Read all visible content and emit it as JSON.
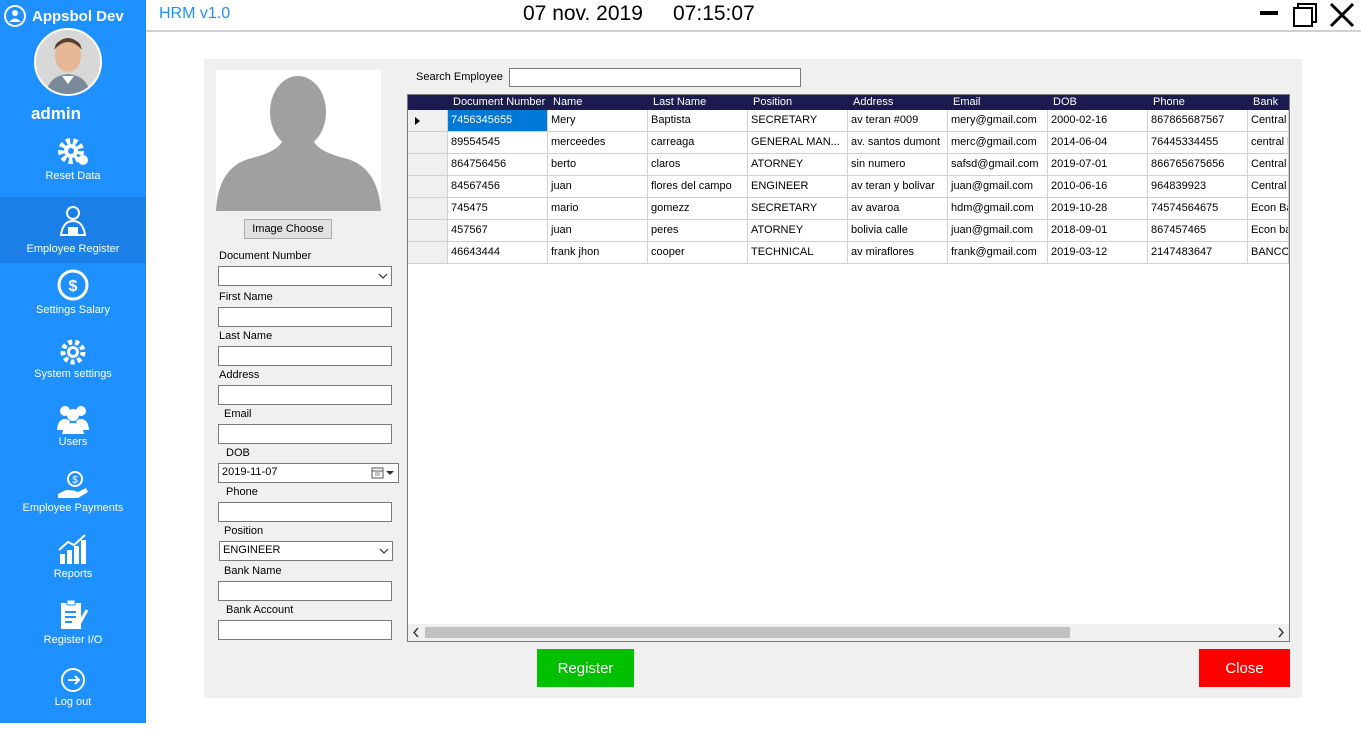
{
  "brand": {
    "name": "Appsbol Dev"
  },
  "user": {
    "name": "admin"
  },
  "nav": [
    {
      "label": "Reset Data",
      "icon": "gear-icon"
    },
    {
      "label": "Employee Register",
      "icon": "employee-icon"
    },
    {
      "label": "Settings Salary",
      "icon": "salary-icon"
    },
    {
      "label": "System settings",
      "icon": "settings-icon"
    },
    {
      "label": "Users",
      "icon": "users-icon"
    },
    {
      "label": "Employee Payments",
      "icon": "payments-icon"
    },
    {
      "label": "Reports",
      "icon": "chart-icon"
    },
    {
      "label": "Register I/O",
      "icon": "clipboard-icon"
    },
    {
      "label": "Log out",
      "icon": "logout-icon"
    }
  ],
  "header": {
    "app": "HRM v1.0",
    "date": "07 nov. 2019",
    "time": "07:15:07"
  },
  "form": {
    "image_button": "Image Choose",
    "document_number_label": "Document Number",
    "first_name_label": "First Name",
    "last_name_label": "Last Name",
    "address_label": "Address",
    "email_label": "Email",
    "dob_label": "DOB",
    "dob_value": "2019-11-07",
    "phone_label": "Phone",
    "position_label": "Position",
    "position_value": "ENGINEER",
    "bank_name_label": "Bank Name",
    "bank_account_label": "Bank Account"
  },
  "search": {
    "label": "Search Employee"
  },
  "table": {
    "columns": [
      "Document Number",
      "Name",
      "Last Name",
      "Position",
      "Address",
      "Email",
      "DOB",
      "Phone",
      "Bank"
    ],
    "rows": [
      [
        "7456345655",
        "Mery",
        "Baptista",
        "SECRETARY",
        "av teran #009",
        "mery@gmail.com",
        "2000-02-16",
        "867865687567",
        "Central"
      ],
      [
        "89554545",
        "merceedes",
        "carreaga",
        "GENERAL MAN...",
        "av. santos dumont",
        "merc@gmail.com",
        "2014-06-04",
        "76445334455",
        "central b"
      ],
      [
        "864756456",
        "berto",
        "claros",
        "ATORNEY",
        "sin numero",
        "safsd@gmail.com",
        "2019-07-01",
        "866765675656",
        "Central"
      ],
      [
        "84567456",
        "juan",
        "flores del campo",
        "ENGINEER",
        "av teran y bolivar",
        "juan@gmail.com",
        "2010-06-16",
        "964839923",
        "Central"
      ],
      [
        "745475",
        "mario",
        "gomezz",
        "SECRETARY",
        "av avaroa",
        "hdm@gmail.com",
        "2019-10-28",
        "74574564675",
        "Econ Ba"
      ],
      [
        "457567",
        "juan",
        "peres",
        "ATORNEY",
        "bolivia calle",
        "juan@gmail.com",
        "2018-09-01",
        "867457465",
        "Econ ba"
      ],
      [
        "46643444",
        "frank jhon",
        "cooper",
        "TECHNICAL",
        "av miraflores",
        "frank@gmail.com",
        "2019-03-12",
        "2147483647",
        "BANCO"
      ]
    ]
  },
  "buttons": {
    "register": "Register",
    "close": "Close"
  },
  "colors": {
    "sidebar": "#1e90ff",
    "grid_header": "#1b1b4f",
    "register": "#00c000",
    "close": "#ff0000",
    "selection": "#0078d7"
  }
}
